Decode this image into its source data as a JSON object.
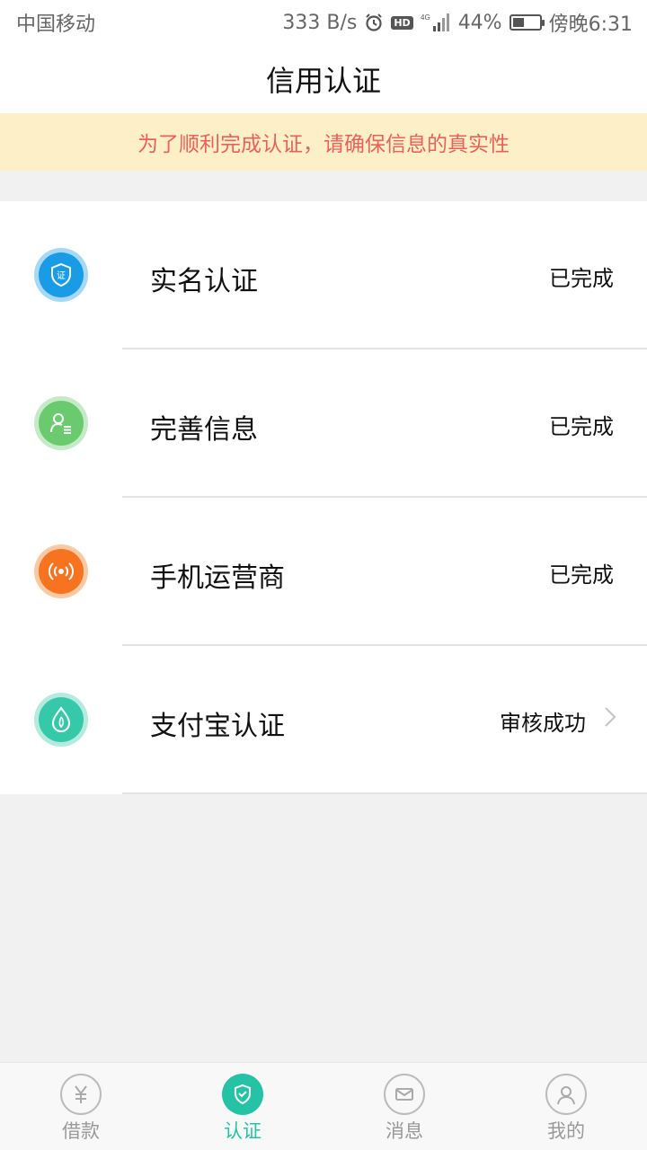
{
  "status_bar": {
    "carrier": "中国移动",
    "network_speed": "333 B/s",
    "signal_type": "4G",
    "hd_label": "HD",
    "battery_percent": "44%",
    "battery_level": 0.44,
    "time": "傍晚6:31"
  },
  "header": {
    "title": "信用认证"
  },
  "notice": {
    "text": "为了顺利完成认证，请确保信息的真实性"
  },
  "colors": {
    "accent": "#26c2a6",
    "notice_bg": "#fdf0c9",
    "notice_text": "#e8625b"
  },
  "items": [
    {
      "label": "实名认证",
      "status": "已完成",
      "icon": "id-shield-icon",
      "color": "#1a9be6",
      "ring": "#a7d9f6"
    },
    {
      "label": "完善信息",
      "status": "已完成",
      "icon": "user-info-icon",
      "color": "#6acb6e",
      "ring": "#c6eac7"
    },
    {
      "label": "手机运营商",
      "status": "已完成",
      "icon": "signal-broadcast-icon",
      "color": "#f7731f",
      "ring": "#fbc9a4"
    },
    {
      "label": "支付宝认证",
      "status": "审核成功",
      "icon": "alipay-drop-icon",
      "color": "#35c9a9",
      "ring": "#b4ebde"
    }
  ],
  "tabs": [
    {
      "label": "借款",
      "icon": "yuan-icon",
      "active": false
    },
    {
      "label": "认证",
      "icon": "shield-check-icon",
      "active": true
    },
    {
      "label": "消息",
      "icon": "mail-icon",
      "active": false
    },
    {
      "label": "我的",
      "icon": "profile-icon",
      "active": false
    }
  ]
}
